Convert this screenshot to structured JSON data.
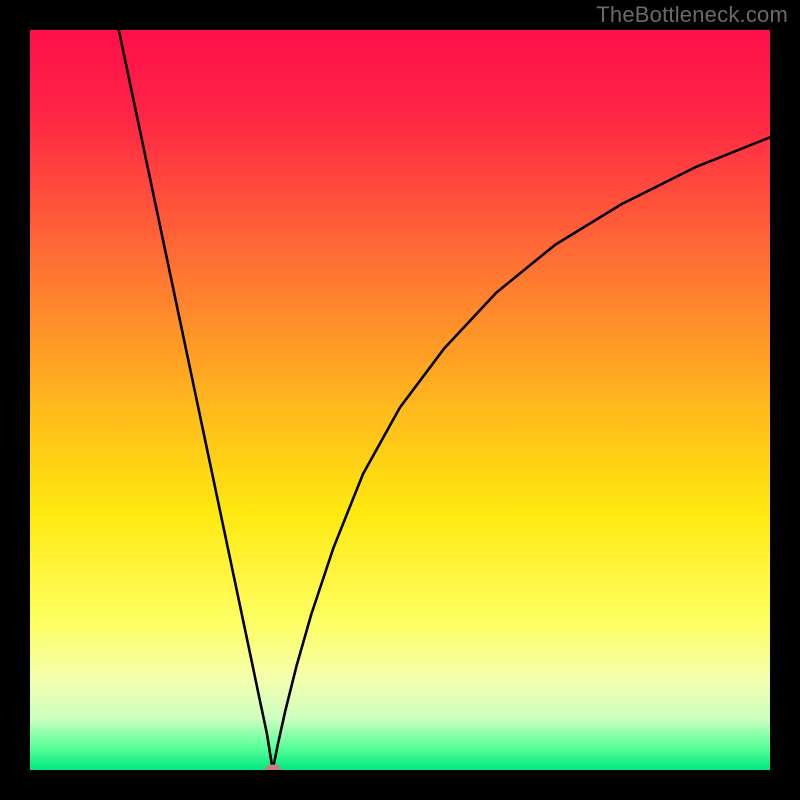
{
  "watermark": "TheBottleneck.com",
  "chart_data": {
    "type": "line",
    "title": "",
    "xlabel": "",
    "ylabel": "",
    "xlim": [
      0,
      100
    ],
    "ylim": [
      0,
      100
    ],
    "background_gradient": {
      "stops": [
        {
          "pos": 0,
          "color": "#ff0e4a"
        },
        {
          "pos": 12,
          "color": "#ff2745"
        },
        {
          "pos": 30,
          "color": "#ff6b35"
        },
        {
          "pos": 50,
          "color": "#ffb61e"
        },
        {
          "pos": 65,
          "color": "#ffe80f"
        },
        {
          "pos": 80,
          "color": "#fdff62"
        },
        {
          "pos": 88,
          "color": "#f4ffb0"
        },
        {
          "pos": 93,
          "color": "#ccffc0"
        },
        {
          "pos": 97,
          "color": "#58ff9a"
        },
        {
          "pos": 100,
          "color": "#00e77f"
        }
      ]
    },
    "series": [
      {
        "name": "left-branch",
        "x": [
          12,
          14,
          16,
          18,
          20,
          22,
          24,
          26,
          28,
          30,
          31,
          32,
          32.8
        ],
        "y": [
          100,
          90.5,
          81,
          71.5,
          62,
          52.5,
          43,
          33.5,
          24,
          14.5,
          9.7,
          5,
          0
        ]
      },
      {
        "name": "right-branch",
        "x": [
          32.8,
          33.5,
          34.5,
          36,
          38,
          41,
          45,
          50,
          56,
          63,
          71,
          80,
          90,
          100
        ],
        "y": [
          0,
          3.5,
          8,
          14,
          21,
          30,
          40,
          49,
          57,
          64.5,
          71,
          76.5,
          81.5,
          85.5
        ]
      }
    ],
    "marker": {
      "x": 32.8,
      "y": 0,
      "color": "#cb7b78"
    }
  }
}
